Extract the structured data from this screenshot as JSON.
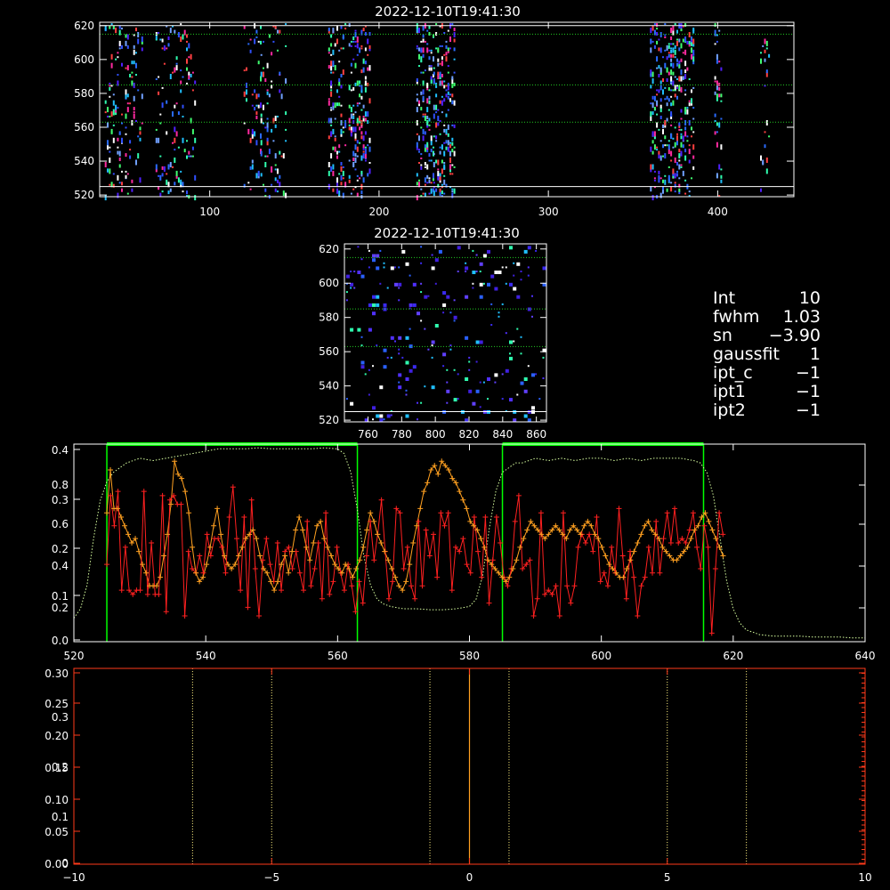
{
  "colors": {
    "background": "#000000",
    "axes": "#ffffff",
    "dotted_green": "#22cc22",
    "fit_box": "#00ff00",
    "series_red": "#ff2020",
    "series_orange": "#ffa020",
    "profile_dotted": "#d8ffa0",
    "lower_axes": "#ff3a1a",
    "lower_center": "#ffa020",
    "lower_dotted": "#fff080"
  },
  "info_panel": {
    "lines": [
      {
        "key": "Int",
        "value": "10"
      },
      {
        "key": "fwhm",
        "value": "1.03"
      },
      {
        "key": "sn",
        "value": "−3.90"
      },
      {
        "key": "gaussfit",
        "value": "1"
      },
      {
        "key": "ipt_c",
        "value": "−1"
      },
      {
        "key": "ipt1",
        "value": "−1"
      },
      {
        "key": "ipt2",
        "value": "−1"
      }
    ]
  },
  "chart_data": [
    {
      "id": "top-image",
      "type": "heatmap",
      "title": "2022-12-10T19:41:30",
      "xlim": [
        35,
        445
      ],
      "ylim": [
        519,
        622
      ],
      "x_ticks": [
        100,
        200,
        300,
        400
      ],
      "y_ticks": [
        520,
        540,
        560,
        580,
        600,
        620
      ],
      "white_lines_y": [
        620,
        525
      ],
      "dotted_lines_y": [
        615,
        585,
        563
      ],
      "pixel_columns": [
        {
          "x0": 38,
          "x1": 48,
          "density": 0.3
        },
        {
          "x0": 50,
          "x1": 60,
          "density": 0.25
        },
        {
          "x0": 68,
          "x1": 80,
          "density": 0.22
        },
        {
          "x0": 80,
          "x1": 92,
          "density": 0.18
        },
        {
          "x0": 120,
          "x1": 130,
          "density": 0.18
        },
        {
          "x0": 130,
          "x1": 145,
          "density": 0.25
        },
        {
          "x0": 170,
          "x1": 180,
          "density": 0.4
        },
        {
          "x0": 182,
          "x1": 195,
          "density": 0.45
        },
        {
          "x0": 222,
          "x1": 232,
          "density": 0.55
        },
        {
          "x0": 232,
          "x1": 245,
          "density": 0.55
        },
        {
          "x0": 360,
          "x1": 372,
          "density": 0.45
        },
        {
          "x0": 372,
          "x1": 386,
          "density": 0.5
        },
        {
          "x0": 398,
          "x1": 402,
          "density": 0.3
        },
        {
          "x0": 425,
          "x1": 430,
          "density": 0.15
        }
      ]
    },
    {
      "id": "middle-image",
      "type": "heatmap",
      "title": "2022-12-10T19:41:30",
      "xlim": [
        746,
        866
      ],
      "ylim": [
        519,
        623
      ],
      "x_ticks": [
        760,
        780,
        800,
        820,
        840,
        860
      ],
      "y_ticks": [
        520,
        540,
        560,
        580,
        600,
        620
      ],
      "white_lines_y": [
        525
      ],
      "dotted_lines_y": [
        615,
        585,
        563
      ],
      "density": 0.11
    },
    {
      "id": "profile-plot",
      "type": "line",
      "xlim": [
        520,
        640
      ],
      "x_ticks": [
        520,
        540,
        560,
        580,
        600,
        620,
        640
      ],
      "y_ticks_inner": [
        "0.0",
        "0.1",
        "0.2",
        "0.3",
        "0.4"
      ],
      "y_ticks_outer": [
        "0.2",
        "0.4",
        "0.6",
        "0.8"
      ],
      "fit_boxes": [
        {
          "x0": 525.0,
          "x1": 563.0
        },
        {
          "x0": 585.0,
          "x1": 615.5
        }
      ],
      "series": [
        {
          "key": "red",
          "x0": 525,
          "dx": 1,
          "ylim": [
            0.0,
            0.46
          ],
          "values": [
            0.18,
            0.34,
            0.27,
            0.35,
            0.12,
            0.22,
            0.12,
            0.11,
            0.12,
            0.12,
            0.35,
            0.11,
            0.23,
            0.11,
            0.11,
            0.34,
            0.07,
            0.33,
            0.34,
            0.32,
            0.32,
            0.06,
            0.21,
            0.17,
            0.16,
            0.2,
            0.16,
            0.25,
            0.2,
            0.24,
            0.24,
            0.22,
            0.16,
            0.29,
            0.36,
            0.24,
            0.12,
            0.29,
            0.08,
            0.33,
            0.17,
            0.06,
            0.19,
            0.24,
            0.18,
            0.14,
            0.23,
            0.12,
            0.21,
            0.22,
            0.17,
            0.21,
            0.16,
            0.12,
            0.28,
            0.13,
            0.17,
            0.23,
            0.1,
            0.3,
            0.11,
            0.14,
            0.22,
            0.16,
            0.12,
            0.18,
            0.13,
            0.07,
            0.14,
            0.09,
            0.2,
            0.28,
            0.19,
            0.25,
            0.33,
            0.21,
            0.1,
            0.14,
            0.31,
            0.3,
            0.17,
            0.22,
            0.13,
            0.1,
            0.28,
            0.13,
            0.26,
            0.2,
            0.25,
            0.15,
            0.3,
            0.27,
            0.3,
            0.12,
            0.22,
            0.21,
            0.24,
            0.18,
            0.16,
            0.29,
            0.21,
            0.15,
            0.29,
            0.09,
            0.19,
            0.29,
            0.23,
            0.15,
            0.13,
            0.17,
            0.28,
            0.34,
            0.17,
            0.18,
            0.19,
            0.06,
            0.1,
            0.3,
            0.11,
            0.12,
            0.11,
            0.13,
            0.06,
            0.3,
            0.13,
            0.09,
            0.13,
            0.22,
            0.25,
            0.23,
            0.25,
            0.21,
            0.29,
            0.14,
            0.16,
            0.13,
            0.22,
            0.16,
            0.31,
            0.2,
            0.1,
            0.21,
            0.15,
            0.06,
            0.13,
            0.15,
            0.22,
            0.16,
            0.28,
            0.16,
            0.24,
            0.3,
            0.23,
            0.31,
            0.23,
            0.24,
            0.23,
            0.26,
            0.3,
            0.22,
            0.17,
            0.27,
            0.22,
            0.02,
            0.17,
            0.3,
            0.25
          ]
        },
        {
          "key": "orange",
          "x0": 525,
          "dx": 1,
          "ylim": [
            0.0,
            0.46
          ],
          "values": [
            0.3,
            0.4,
            0.31,
            0.31,
            0.29,
            0.27,
            0.25,
            0.23,
            0.24,
            0.21,
            0.18,
            0.16,
            0.13,
            0.13,
            0.13,
            0.15,
            0.2,
            0.25,
            0.32,
            0.42,
            0.39,
            0.38,
            0.35,
            0.3,
            0.22,
            0.16,
            0.14,
            0.15,
            0.18,
            0.22,
            0.27,
            0.31,
            0.25,
            0.2,
            0.18,
            0.17,
            0.18,
            0.2,
            0.22,
            0.24,
            0.25,
            0.26,
            0.24,
            0.2,
            0.17,
            0.16,
            0.14,
            0.12,
            0.14,
            0.18,
            0.2,
            0.16,
            0.21,
            0.26,
            0.29,
            0.26,
            0.22,
            0.19,
            0.23,
            0.27,
            0.28,
            0.24,
            0.22,
            0.2,
            0.18,
            0.17,
            0.16,
            0.18,
            0.17,
            0.15,
            0.17,
            0.19,
            0.22,
            0.26,
            0.3,
            0.28,
            0.25,
            0.23,
            0.21,
            0.19,
            0.17,
            0.15,
            0.13,
            0.12,
            0.14,
            0.18,
            0.23,
            0.27,
            0.31,
            0.35,
            0.37,
            0.4,
            0.41,
            0.39,
            0.42,
            0.41,
            0.4,
            0.38,
            0.37,
            0.35,
            0.33,
            0.31,
            0.28,
            0.27,
            0.26,
            0.24,
            0.22,
            0.19,
            0.18,
            0.17,
            0.16,
            0.15,
            0.14,
            0.15,
            0.17,
            0.19,
            0.22,
            0.24,
            0.26,
            0.28,
            0.27,
            0.26,
            0.25,
            0.24,
            0.25,
            0.26,
            0.27,
            0.26,
            0.25,
            0.24,
            0.26,
            0.27,
            0.26,
            0.25,
            0.27,
            0.28,
            0.27,
            0.25,
            0.24,
            0.22,
            0.2,
            0.18,
            0.17,
            0.16,
            0.15,
            0.15,
            0.17,
            0.19,
            0.21,
            0.23,
            0.25,
            0.27,
            0.28,
            0.26,
            0.25,
            0.24,
            0.22,
            0.21,
            0.2,
            0.19,
            0.19,
            0.2,
            0.21,
            0.22,
            0.24,
            0.26,
            0.27,
            0.29,
            0.3,
            0.28,
            0.26,
            0.24,
            0.22,
            0.2
          ]
        },
        {
          "key": "profile",
          "x": [
            520,
            521,
            522,
            523,
            524,
            525,
            526,
            527,
            528,
            530,
            532,
            534,
            536,
            538,
            540,
            542,
            544,
            546,
            548,
            550,
            552,
            554,
            556,
            558,
            560,
            561,
            562,
            563,
            564,
            565,
            566,
            567,
            568,
            570,
            572,
            574,
            576,
            578,
            580,
            581,
            582,
            583,
            584,
            585,
            586,
            587,
            588,
            590,
            592,
            594,
            596,
            598,
            600,
            602,
            604,
            606,
            608,
            610,
            612,
            614,
            615,
            616,
            617,
            618,
            619,
            620,
            621,
            622,
            623,
            624,
            626,
            628,
            630,
            632,
            634,
            636,
            638,
            640
          ],
          "ylim": [
            0.0,
            0.42
          ],
          "values": [
            0.05,
            0.07,
            0.12,
            0.22,
            0.3,
            0.34,
            0.36,
            0.37,
            0.38,
            0.39,
            0.385,
            0.39,
            0.395,
            0.4,
            0.405,
            0.41,
            0.41,
            0.41,
            0.412,
            0.41,
            0.41,
            0.41,
            0.41,
            0.412,
            0.41,
            0.4,
            0.36,
            0.28,
            0.18,
            0.12,
            0.09,
            0.08,
            0.075,
            0.07,
            0.07,
            0.068,
            0.068,
            0.07,
            0.075,
            0.09,
            0.14,
            0.24,
            0.32,
            0.36,
            0.37,
            0.38,
            0.38,
            0.39,
            0.385,
            0.39,
            0.385,
            0.39,
            0.39,
            0.385,
            0.39,
            0.385,
            0.39,
            0.39,
            0.39,
            0.385,
            0.38,
            0.36,
            0.31,
            0.22,
            0.13,
            0.07,
            0.04,
            0.025,
            0.02,
            0.015,
            0.012,
            0.012,
            0.012,
            0.01,
            0.01,
            0.01,
            0.008,
            0.008
          ]
        }
      ]
    },
    {
      "id": "lower-plot",
      "type": "line",
      "xlim": [
        -10,
        10
      ],
      "x_ticks": [
        "−10",
        "−5",
        "0",
        "5",
        "10"
      ],
      "x_tick_values": [
        -10,
        -5,
        0,
        5,
        10
      ],
      "y_ticks_inner": [
        "0.00",
        "0.05",
        "0.10",
        "0.15",
        "0.20",
        "0.25",
        "0.30"
      ],
      "y_ticks_outer": [
        "0",
        "0.1",
        "0.2",
        "0.3"
      ],
      "center_line_x": 0,
      "dotted_lines_x": [
        -7,
        -5,
        -1,
        1,
        5,
        7
      ]
    }
  ]
}
